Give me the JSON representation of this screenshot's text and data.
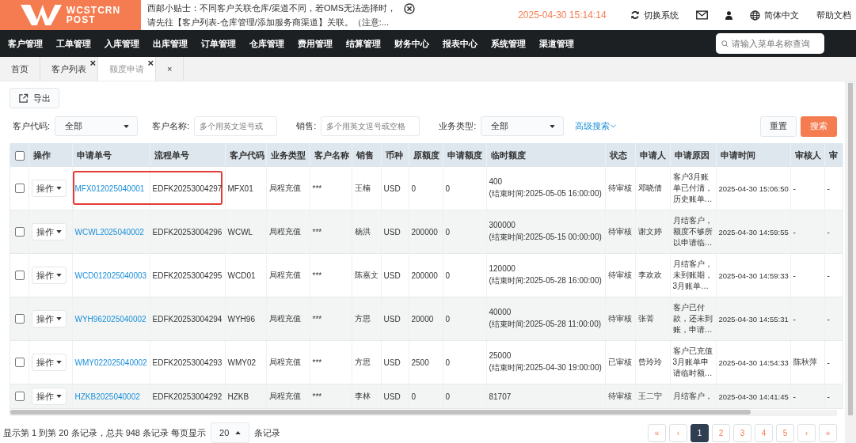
{
  "logo": {
    "line1": "WCSTCRN",
    "line2": "POST"
  },
  "notice": {
    "line1": "西邮小贴士：不同客户关联仓库/渠道不同，若OMS无法选择时，",
    "line2": "请先往【客户列表-仓库管理/添加服务商渠道】关联。（注意:..."
  },
  "datetime": "2025-04-30 15:14:14",
  "header_links": [
    {
      "kind": "switch",
      "label": "切换系统"
    },
    {
      "kind": "mail"
    },
    {
      "kind": "user"
    },
    {
      "kind": "language",
      "label": "简体中文"
    },
    {
      "kind": "help",
      "label": "帮助文档"
    }
  ],
  "nav": {
    "items": [
      "客户管理",
      "工单管理",
      "入库管理",
      "出库管理",
      "订单管理",
      "仓库管理",
      "费用管理",
      "结算管理",
      "财务中心",
      "报表中心",
      "系统管理",
      "渠道管理"
    ],
    "search_placeholder": "请输入菜单名称查询"
  },
  "tabs": [
    {
      "label": "首页",
      "selected": false
    },
    {
      "label": "客户列表",
      "close": "×",
      "selected": false
    },
    {
      "label": "额度申请",
      "close": "×",
      "selected": true
    },
    {
      "label": "×",
      "selected": false
    }
  ],
  "export_button": "导出",
  "filters": [
    {
      "kind": "select",
      "label": "客户代码:",
      "value": "全部"
    },
    {
      "kind": "input",
      "label": "客户名称:",
      "placeholder": "多个用英文逗号或"
    },
    {
      "kind": "input",
      "label": "销售:",
      "placeholder": "多个用英文逗号或空格"
    },
    {
      "kind": "select",
      "label": "业务类型:",
      "value": "全部"
    }
  ],
  "advanced_search": "高级搜索",
  "reset_button": "重置",
  "search_button": "搜索",
  "table": {
    "all_checked": false,
    "columns": [
      "操作",
      "申请单号",
      "流程单号",
      "客户代码",
      "业务类型",
      "客户名称",
      "销售",
      "币种",
      "原额度",
      "申请额度",
      "临时额度",
      "状态",
      "申请人",
      "申请原因",
      "申请时间",
      "审核人",
      "审"
    ],
    "rows": [
      {
        "checked": false,
        "action": "操作",
        "code": "MFX012025040001",
        "flow": "EDFK20253004297",
        "cust_code": "MFX01",
        "biz_type": "局程充值",
        "cust_name": "***",
        "sales": "王楠",
        "currency": "USD",
        "original": "0",
        "applied": "0",
        "temp": "400",
        "temp_end": "(结束时间:2025-05-05 16:00:00)",
        "status": "待审核",
        "applicant": "邓晓倩",
        "reason": "客户3月账单已付清，历史账单…",
        "time": "2025-04-30 15:06:50",
        "reviewer": "-",
        "column_17": "-",
        "highlighted": true
      },
      {
        "checked": false,
        "action": "操作",
        "code": "WCWL2025040002",
        "flow": "EDFK20253004296",
        "cust_code": "WCWL",
        "biz_type": "局程充值",
        "cust_name": "***",
        "sales": "杨洪",
        "currency": "USD",
        "original": "200000",
        "applied": "0",
        "temp": "300000",
        "temp_end": "(结束时间:2025-05-15 00:00:00)",
        "status": "待审核",
        "applicant": "谢文婷",
        "reason": "月结客户，额度不够所以申请临…",
        "time": "2025-04-30 14:59:55",
        "reviewer": "-",
        "column_17": "-",
        "highlighted": false
      },
      {
        "checked": false,
        "action": "操作",
        "code": "WCD012025040003",
        "flow": "EDFK20253004295",
        "cust_code": "WCD01",
        "biz_type": "局程充值",
        "cust_name": "***",
        "sales": "陈嘉文",
        "currency": "USD",
        "original": "200000",
        "applied": "0",
        "temp": "120000",
        "temp_end": "(结束时间:2025-05-28 16:00:00)",
        "status": "待审核",
        "applicant": "李欢欢",
        "reason": "月结客户，未到账期，3月账单…",
        "time": "2025-04-30 14:59:33",
        "reviewer": "-",
        "column_17": "-",
        "highlighted": false
      },
      {
        "checked": false,
        "action": "操作",
        "code": "WYH962025040002",
        "flow": "EDFK20253004294",
        "cust_code": "WYH96",
        "biz_type": "局程充值",
        "cust_name": "***",
        "sales": "方思",
        "currency": "USD",
        "original": "20000",
        "applied": "0",
        "temp": "40000",
        "temp_end": "(结束时间:2025-05-28 11:00:00)",
        "status": "待审核",
        "applicant": "张菁",
        "reason": "客户已付款，还未到账，申请…",
        "time": "2025-04-30 14:55:31",
        "reviewer": "-",
        "column_17": "-",
        "highlighted": false
      },
      {
        "checked": false,
        "action": "操作",
        "code": "WMY022025040002",
        "flow": "EDFK20253004293",
        "cust_code": "WMY02",
        "biz_type": "局程充值",
        "cust_name": "***",
        "sales": "方思",
        "currency": "USD",
        "original": "2500",
        "applied": "0",
        "temp": "25000",
        "temp_end": "(结束时间:2025-04-30 19:00:00)",
        "status": "已审核",
        "applicant": "曾玲玲",
        "reason": "客户已充值3月账单申请临时额…",
        "time": "2025-04-30 14:54:33",
        "reviewer": "陈秋萍",
        "column_17": "-",
        "highlighted": false
      },
      {
        "checked": false,
        "action": "操作",
        "code": "HZKB2025040002",
        "flow": "EDFK20253004292",
        "cust_code": "HZKB",
        "biz_type": "局程充值",
        "cust_name": "***",
        "sales": "李林",
        "currency": "USD",
        "original": "0",
        "applied": "0",
        "temp": "81707",
        "status": "待审核",
        "applicant": "王二宁",
        "reason": "月结客户，",
        "time": "2025-04-30 14:41:45",
        "reviewer": "-",
        "column_17": "-",
        "highlighted": false
      }
    ]
  },
  "footer": {
    "summary": "显示第 1 到第 20 条记录，总共 948 条记录 每页显示",
    "page_size": "20",
    "suffix": "条记录"
  },
  "pagination": [
    {
      "label": "«",
      "selected": false
    },
    {
      "label": "‹",
      "selected": false
    },
    {
      "label": "1",
      "selected": true
    },
    {
      "label": "2",
      "selected": false
    },
    {
      "label": "3",
      "selected": false
    },
    {
      "label": "4",
      "selected": false
    },
    {
      "label": "5",
      "selected": false
    },
    {
      "label": "›",
      "selected": false
    },
    {
      "label": "»",
      "selected": false
    }
  ]
}
